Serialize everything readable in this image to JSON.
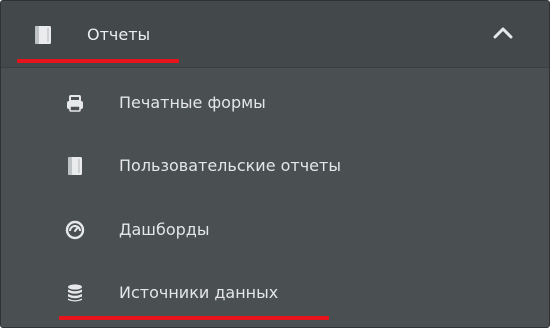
{
  "menu": {
    "header": {
      "label": "Отчеты",
      "icon": "book-icon",
      "expanded": true
    },
    "items": [
      {
        "label": "Печатные формы",
        "icon": "printer-icon"
      },
      {
        "label": "Пользовательские отчеты",
        "icon": "book-icon"
      },
      {
        "label": "Дашборды",
        "icon": "dashboard-gauge-icon"
      },
      {
        "label": "Источники данных",
        "icon": "database-icon"
      }
    ]
  },
  "colors": {
    "panel_background": "#4a4f52",
    "header_background": "#43484b",
    "text": "#e6e8e9",
    "highlight_underline": "#e8141c"
  }
}
